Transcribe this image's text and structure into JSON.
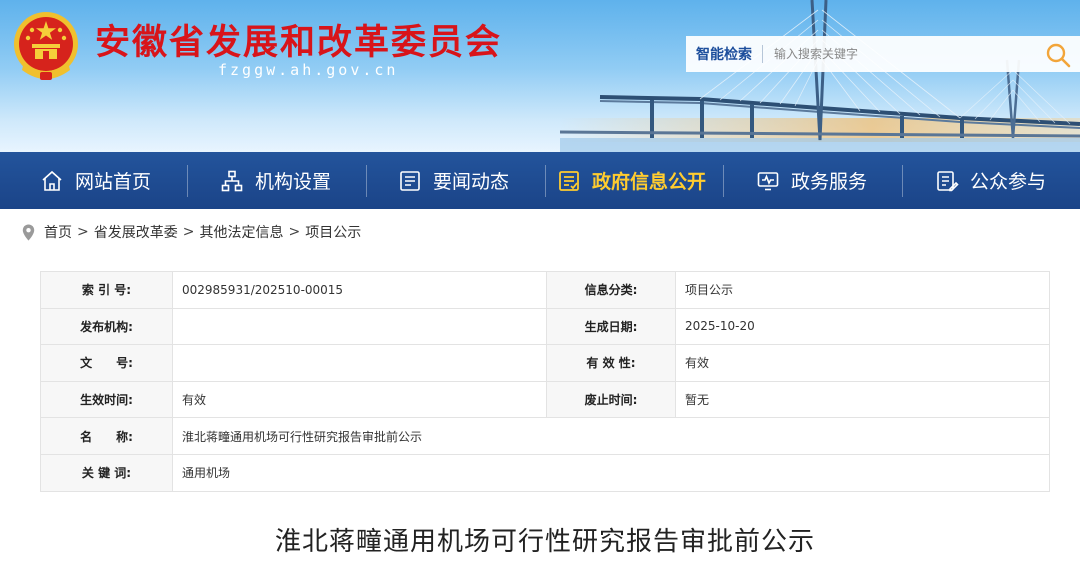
{
  "header": {
    "site_title": "安徽省发展和改革委员会",
    "site_domain": "fzggw.ah.gov.cn",
    "search": {
      "label": "智能检索",
      "placeholder": "输入搜索关键字"
    }
  },
  "nav": {
    "items": [
      {
        "label": "网站首页",
        "icon": "home-icon"
      },
      {
        "label": "机构设置",
        "icon": "org-chart-icon"
      },
      {
        "label": "要闻动态",
        "icon": "news-icon"
      },
      {
        "label": "政府信息公开",
        "icon": "document-icon",
        "active": true
      },
      {
        "label": "政务服务",
        "icon": "monitor-icon"
      },
      {
        "label": "公众参与",
        "icon": "form-icon"
      }
    ],
    "active_color": "#ffcc2f",
    "background": "#1f4d94"
  },
  "breadcrumb": {
    "items": [
      "首页",
      "省发展改革委",
      "其他法定信息",
      "项目公示"
    ],
    "separator": ">"
  },
  "info": {
    "index_no": {
      "label": "索 引 号:",
      "value": "002985931/202510-00015"
    },
    "category": {
      "label": "信息分类:",
      "value": "项目公示"
    },
    "publisher": {
      "label": "发布机构:",
      "value": ""
    },
    "date": {
      "label": "生成日期:",
      "value": "2025-10-20"
    },
    "doc_no": {
      "label": "文　　号:",
      "value": ""
    },
    "validity": {
      "label": "有 效 性:",
      "value": "有效"
    },
    "effective": {
      "label": "生效时间:",
      "value": "有效"
    },
    "expiry": {
      "label": "废止时间:",
      "value": "暂无"
    },
    "name": {
      "label": "名　　称:",
      "value": "淮北蒋疃通用机场可行性研究报告审批前公示"
    },
    "keywords": {
      "label": "关 键 词:",
      "value": "通用机场"
    }
  },
  "article": {
    "title": "淮北蒋疃通用机场可行性研究报告审批前公示"
  }
}
